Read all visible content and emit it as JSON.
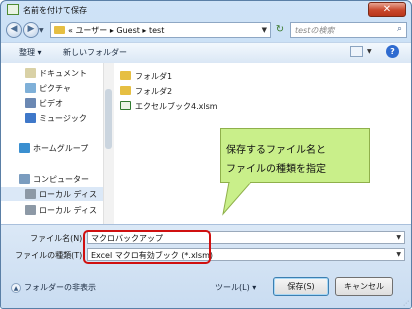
{
  "window": {
    "title": "名前を付けて保存",
    "close_symbol": "✕",
    "title_icon": "excel-icon"
  },
  "navigation": {
    "back_icon": "back-arrow-icon",
    "forward_icon": "forward-arrow-icon",
    "breadcrumb": "« ユーザー ▸ Guest ▸ test",
    "search_placeholder": "testの検索"
  },
  "toolbar": {
    "organize": "整理 ▾",
    "new_folder": "新しいフォルダー"
  },
  "sidebar": {
    "items": [
      {
        "label": "ドキュメント",
        "icon": "documents-icon",
        "color": "#d9d1a6"
      },
      {
        "label": "ピクチャ",
        "icon": "pictures-icon",
        "color": "#7fb0d8"
      },
      {
        "label": "ビデオ",
        "icon": "video-icon",
        "color": "#6b88b3"
      },
      {
        "label": "ミュージック",
        "icon": "music-icon",
        "color": "#3f78c9"
      },
      {
        "label": "ホームグループ",
        "icon": "homegroup-icon",
        "color": "#3a8fd0"
      },
      {
        "label": "コンピューター",
        "icon": "computer-icon",
        "color": "#7a9cbf"
      },
      {
        "label": "ローカル ディス",
        "icon": "local-disk-icon",
        "color": "#8d99a6"
      },
      {
        "label": "ローカル ディス",
        "icon": "local-disk-icon",
        "color": "#8d99a6"
      }
    ]
  },
  "files": [
    {
      "label": "フォルダ1",
      "icon": "folder-icon"
    },
    {
      "label": "フォルダ2",
      "icon": "folder-icon"
    },
    {
      "label": "エクセルブック4.xlsm",
      "icon": "excel-file-icon"
    }
  ],
  "callout": {
    "line1": "保存するファイル名と",
    "line2": "ファイルの種類を指定",
    "color": "#c9ef8a"
  },
  "form": {
    "filename_label": "ファイル名(N):",
    "filename_value": "マクロバックアップ",
    "filetype_label": "ファイルの種類(T):",
    "filetype_value": "Excel マクロ有効ブック (*.xlsm)",
    "highlight_color": "#d01010"
  },
  "footer": {
    "hide_folders": "フォルダーの非表示",
    "tools": "ツール(L) ▾",
    "save": "保存(S)",
    "cancel": "キャンセル"
  }
}
